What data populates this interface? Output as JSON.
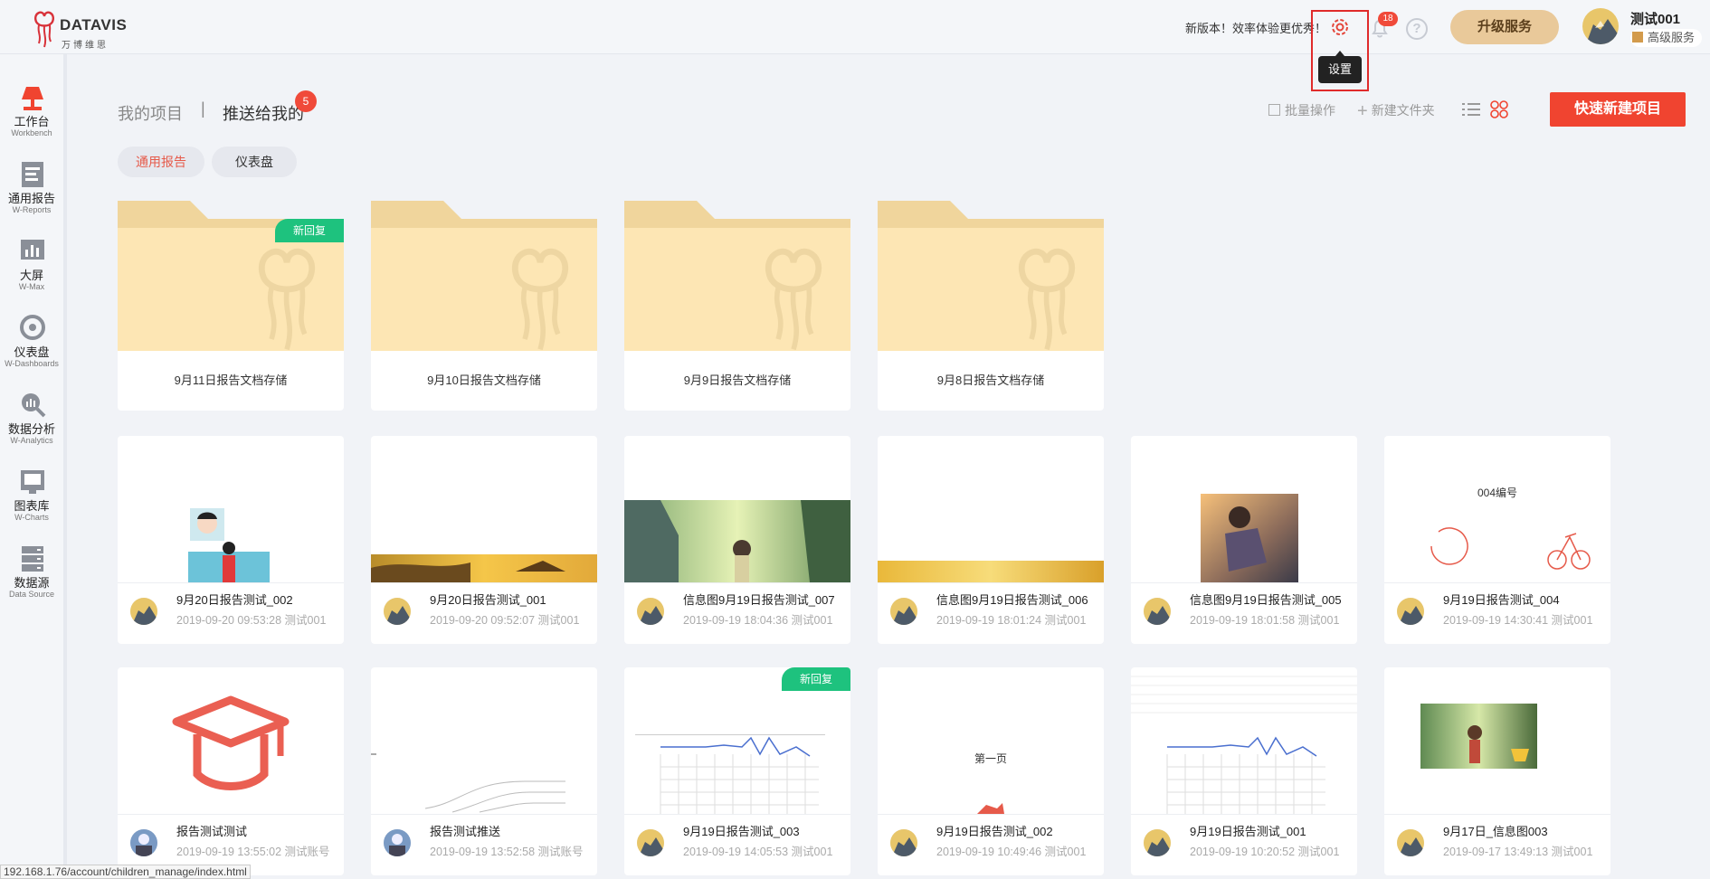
{
  "brand": {
    "name": "DATAVIS",
    "sub": "万博维思"
  },
  "header": {
    "promo": "新版本！效率体验更优秀！",
    "settings_tooltip": "设置",
    "notification_count": "18",
    "help_symbol": "?",
    "upgrade_label": "升级服务",
    "user_name": "测试001",
    "user_level": "高级服务"
  },
  "sidebar": {
    "items": [
      {
        "zh": "工作台",
        "en": "Workbench"
      },
      {
        "zh": "通用报告",
        "en": "W-Reports"
      },
      {
        "zh": "大屏",
        "en": "W-Max"
      },
      {
        "zh": "仪表盘",
        "en": "W-Dashboards"
      },
      {
        "zh": "数据分析",
        "en": "W-Analytics"
      },
      {
        "zh": "图表库",
        "en": "W-Charts"
      },
      {
        "zh": "数据源",
        "en": "Data Source"
      }
    ]
  },
  "main": {
    "tab_mine": "我的项目",
    "tab_sep": "|",
    "tab_pushed": "推送给我的",
    "tab_pushed_badge": "5",
    "filters": [
      "通用报告",
      "仪表盘"
    ],
    "batch_label": "批量操作",
    "new_folder_label": "新建文件夹",
    "new_project_label": "快速新建项目",
    "new_reply_label": "新回复"
  },
  "folders": [
    {
      "name": "9月11日报告文档存储",
      "new_reply": true
    },
    {
      "name": "9月10日报告文档存储",
      "new_reply": false
    },
    {
      "name": "9月9日报告文档存储",
      "new_reply": false
    },
    {
      "name": "9月8日报告文档存储",
      "new_reply": false
    }
  ],
  "cards": [
    {
      "title": "9月20日报告测试_002",
      "sub": "2019-09-20 09:53:28 测试001",
      "thumb": "person"
    },
    {
      "title": "9月20日报告测试_001",
      "sub": "2019-09-20 09:52:07 测试001",
      "thumb": "sunset"
    },
    {
      "title": "信息图9月19日报告测试_007",
      "sub": "2019-09-19 18:04:36 测试001",
      "thumb": "scene"
    },
    {
      "title": "信息图9月19日报告测试_006",
      "sub": "2019-09-19 18:01:24 测试001",
      "thumb": "goldbar"
    },
    {
      "title": "信息图9月19日报告测试_005",
      "sub": "2019-09-19 18:01:58 测试001",
      "thumb": "photo"
    },
    {
      "title": "9月19日报告测试_004",
      "sub": "2019-09-19 14:30:41 测试001",
      "thumb": "icons",
      "thumb_text": "004编号"
    },
    {
      "title": "报告测试测试",
      "sub": "2019-09-19 13:55:02 测试账号",
      "thumb": "cap"
    },
    {
      "title": "报告测试推送",
      "sub": "2019-09-19 13:52:58 测试账号",
      "thumb": "lines"
    },
    {
      "title": "9月19日报告测试_003",
      "sub": "2019-09-19 14:05:53 测试001",
      "thumb": "table",
      "new_reply": true
    },
    {
      "title": "9月19日报告测试_002",
      "sub": "2019-09-19 10:49:46 测试001",
      "thumb": "page",
      "thumb_text": "第一页"
    },
    {
      "title": "9月19日报告测试_001",
      "sub": "2019-09-19 10:20:52 测试001",
      "thumb": "table2"
    },
    {
      "title": "9月17日_信息图003",
      "sub": "2019-09-17 13:49:13 测试001",
      "thumb": "scene2"
    }
  ],
  "status_url": "192.168.1.76/account/children_manage/index.html"
}
